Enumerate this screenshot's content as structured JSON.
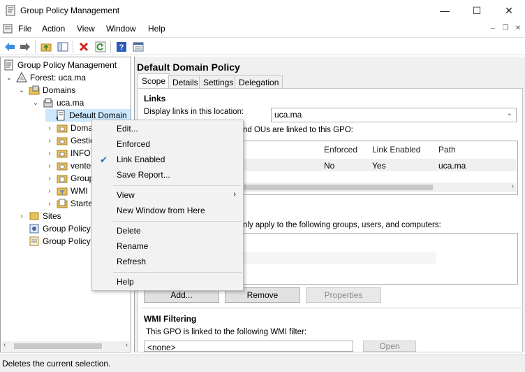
{
  "window": {
    "title": "Group Policy Management",
    "minimize_symbol": "—",
    "maximize_symbol": "☐",
    "close_symbol": "✕"
  },
  "menubar": {
    "items": [
      "File",
      "Action",
      "View",
      "Window",
      "Help"
    ],
    "mdi_min": "–",
    "mdi_restore": "❐",
    "mdi_close": "✕"
  },
  "toolbar": {
    "icons": [
      "back-arrow-icon",
      "forward-arrow-icon",
      "up-folder-icon",
      "show-hide-tree-icon",
      "delete-icon",
      "refresh-icon",
      "help-icon",
      "properties-icon"
    ]
  },
  "tree": {
    "root": "Group Policy Management",
    "forest": "Forest: uca.ma",
    "domains": "Domains",
    "domain": "uca.ma",
    "selected": "Default Domain",
    "children": [
      "Doma",
      "Gestic",
      "INFO",
      "vente",
      "Group",
      "WMI",
      "Starte"
    ],
    "sites": "Sites",
    "modeling": "Group Policy",
    "results": "Group Policy"
  },
  "details": {
    "title": "Default Domain Policy",
    "tabs": [
      "Scope",
      "Details",
      "Settings",
      "Delegation"
    ],
    "links_heading": "Links",
    "display_links_label": "Display links in this location:",
    "location_value": "uca.ma",
    "linked_text": "nd OUs are linked to this GPO:",
    "columns": [
      "Enforced",
      "Link Enabled",
      "Path"
    ],
    "row": {
      "enforced": "No",
      "link_enabled": "Yes",
      "path": "uca.ma"
    },
    "security_text": "nly apply to the following groups, users, and computers:",
    "buttons": {
      "add": "Add...",
      "remove": "Remove",
      "properties": "Properties"
    },
    "wmi_heading": "WMI Filtering",
    "wmi_text": "This GPO is linked to the following WMI filter:",
    "wmi_value": "<none>",
    "open_button": "Open"
  },
  "context_menu": {
    "items": {
      "edit": "Edit...",
      "enforced": "Enforced",
      "link_enabled": "Link Enabled",
      "save_report": "Save Report...",
      "view": "View",
      "new_window": "New Window from Here",
      "delete": "Delete",
      "rename": "Rename",
      "refresh": "Refresh",
      "help": "Help"
    },
    "checked_item": "link_enabled",
    "highlighted_item": "delete",
    "check_glyph": "✔",
    "submenu_glyph": "›"
  },
  "status": {
    "text": "Deletes the current selection."
  },
  "colors": {
    "selection": "#cce8ff",
    "menu_highlight": "#91c9f7",
    "check": "#1a6fc4"
  }
}
